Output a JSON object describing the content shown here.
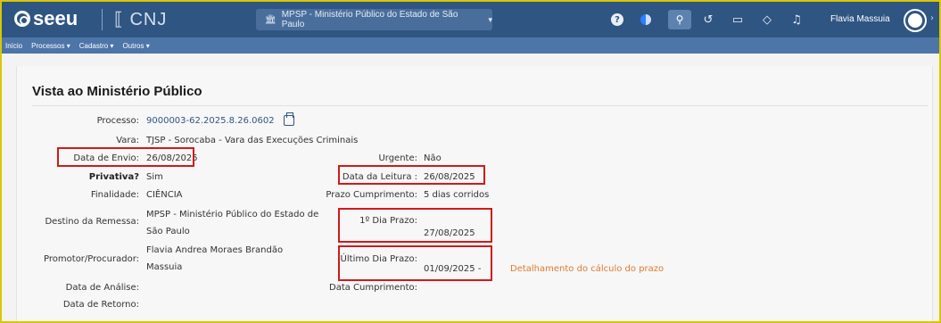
{
  "header": {
    "logo_text": "seeu",
    "partner_logo": "CNJ",
    "org_select": "MPSP - Ministério Público do Estado de São Paulo",
    "user_name": "Flavia Massuia"
  },
  "menu": [
    "Início",
    "Processos",
    "Cadastro",
    "Outros"
  ],
  "page": {
    "title": "Vista ao Ministério Público"
  },
  "fields": {
    "processo_label": "Processo:",
    "processo_value": "9000003-62.2025.8.26.0602",
    "vara_label": "Vara:",
    "vara_value": "TJSP - Sorocaba - Vara das Execuções Criminais",
    "envio_label": "Data de Envio:",
    "envio_value": "26/08/2025",
    "urgente_label": "Urgente:",
    "urgente_value": "Não",
    "privativa_label": "Privativa?",
    "privativa_value": "Sim",
    "leitura_label": "Data da Leitura :",
    "leitura_value": "26/08/2025",
    "finalidade_label": "Finalidade:",
    "finalidade_value": "CIÊNCIA",
    "prazo_label": "Prazo Cumprimento:",
    "prazo_value": "5 dias corridos",
    "destino_label": "Destino da Remessa:",
    "destino_value_1": "MPSP - Ministério Público do Estado de",
    "destino_value_2": "São Paulo",
    "primeiro_label": "1º Dia Prazo:",
    "primeiro_value": "27/08/2025",
    "promotor_label": "Promotor/Procurador:",
    "promotor_value_1": "Flavia Andrea Moraes Brandão",
    "promotor_value_2": "Massuia",
    "ultimo_label": "Último Dia Prazo:",
    "ultimo_value": "01/09/2025 -",
    "detalhamento_link": "Detalhamento do cálculo do prazo",
    "analise_label": "Data de Análise:",
    "cumprimento_label": "Data Cumprimento:",
    "retorno_label": "Data de Retorno:"
  },
  "colors": {
    "topbar": "#2f5582",
    "menubar": "#4d75a8",
    "highlight": "#d11a1a",
    "link": "#e07a2e"
  },
  "icons": [
    "help-icon",
    "theme-toggle-icon",
    "search-icon",
    "history-icon",
    "bookmark-icon",
    "tag-icon",
    "bell-icon",
    "user-avatar-icon",
    "copy-icon"
  ]
}
